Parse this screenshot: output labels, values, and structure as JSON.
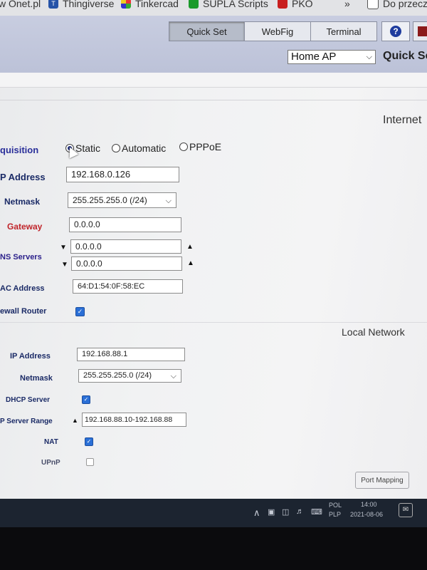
{
  "bookmarks": [
    {
      "label": "w Onet.pl",
      "icon": "none"
    },
    {
      "label": "Thingiverse",
      "icon": "thingiverse-icon"
    },
    {
      "label": "Tinkercad",
      "icon": "tinkercad-icon"
    },
    {
      "label": "SUPLA Scripts",
      "icon": "supla-icon"
    },
    {
      "label": "PKO",
      "icon": "pko-icon"
    },
    {
      "label": "»",
      "icon": "none"
    },
    {
      "label": "Do przeczy",
      "icon": "reading-list-icon"
    }
  ],
  "nav": {
    "quick_set": "Quick Set",
    "webfig": "WebFig",
    "terminal": "Terminal",
    "help": "?"
  },
  "mode_select": {
    "value": "Home AP"
  },
  "page_label": "Quick Se",
  "internet": {
    "section_title": "Internet",
    "acquisition_label": "quisition",
    "options": [
      "Static",
      "Automatic",
      "PPPoE"
    ],
    "selected": "Static",
    "ip_label": "P Address",
    "ip_value": "192.168.0.126",
    "netmask_label": "Netmask",
    "netmask_value": "255.255.255.0 (/24)",
    "gateway_label": "Gateway",
    "gateway_value": "0.0.0.0",
    "dns_label": "NS Servers",
    "dns_values": [
      "0.0.0.0",
      "0.0.0.0"
    ],
    "mac_label": "AC Address",
    "mac_value": "64:D1:54:0F:58:EC",
    "firewall_label": "ewall Router",
    "firewall_checked": true
  },
  "local": {
    "section_title": "Local Network",
    "ip_label": "IP Address",
    "ip_value": "192.168.88.1",
    "netmask_label": "Netmask",
    "netmask_value": "255.255.255.0 (/24)",
    "dhcp_label": "DHCP Server",
    "dhcp_checked": true,
    "range_label": "P Server Range",
    "range_value": "192.168.88.10-192.168.88",
    "nat_label": "NAT",
    "nat_checked": true,
    "upnp_label": "UPnP",
    "upnp_checked": false,
    "port_mapping": "Port Mapping"
  },
  "taskbar": {
    "lang_top": "POL",
    "lang_bottom": "PLP",
    "time": "14:00",
    "date": "2021-08-06"
  }
}
